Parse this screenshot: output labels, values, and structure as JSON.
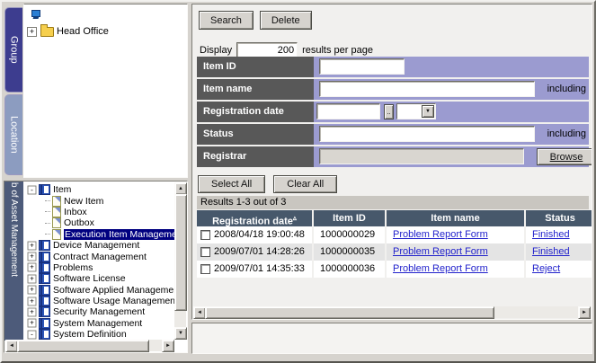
{
  "colors": {
    "window_chrome": "#d6d3ce",
    "panel_bg": "#f1f0ee",
    "form_label_bg": "#585858",
    "form_row_bg": "#9b9bd0",
    "table_header_bg": "#47586b",
    "link_blue": "#2222cc",
    "selection_navy": "#000080",
    "group_tab_bg": "#3d3d8f",
    "location_tab_bg": "#8c9cc0",
    "sidebar_bar_bg": "#4d5b7a"
  },
  "left_top_panel": {
    "tabs": [
      {
        "label": "Group"
      },
      {
        "label": "Location"
      }
    ],
    "tree": {
      "items": [
        {
          "label": "Head Office",
          "expander": "+"
        }
      ]
    }
  },
  "left_bottom_panel": {
    "sidebar_label": "b of Asset Management",
    "tree": [
      {
        "label": "Item",
        "expander": "-"
      },
      {
        "label": "New Item"
      },
      {
        "label": "Inbox"
      },
      {
        "label": "Outbox"
      },
      {
        "label": "Execution Item Management"
      },
      {
        "label": "Device Management",
        "expander": "+"
      },
      {
        "label": "Contract Management",
        "expander": "+"
      },
      {
        "label": "Problems",
        "expander": "+"
      },
      {
        "label": "Software License",
        "expander": "+"
      },
      {
        "label": "Software Applied Management",
        "expander": "+"
      },
      {
        "label": "Software Usage Management",
        "expander": "+"
      },
      {
        "label": "Security Management",
        "expander": "+"
      },
      {
        "label": "System Management",
        "expander": "+"
      },
      {
        "label": "System Definition",
        "expander": "-"
      }
    ]
  },
  "toolbar": {
    "search_label": "Search",
    "delete_label": "Delete"
  },
  "display": {
    "label_before": "Display",
    "value": "200",
    "label_after": "results per page"
  },
  "form": {
    "date_button_label": "..",
    "select_arrow": "▼",
    "rows": [
      {
        "label": "Item ID"
      },
      {
        "label": "Item name",
        "suffix": "including"
      },
      {
        "label": "Registration date"
      },
      {
        "label": "Status",
        "suffix": "including"
      },
      {
        "label": "Registrar",
        "browse_label": "Browse"
      }
    ]
  },
  "selection": {
    "select_all_label": "Select All",
    "clear_all_label": "Clear All"
  },
  "results": {
    "summary": "Results 1-3 out of 3",
    "sort_indicator": "▵",
    "columns": [
      "Registration date",
      "Item ID",
      "Item name",
      "Status"
    ],
    "rows": [
      {
        "registration_date": "2008/04/18 19:00:48",
        "item_id": "1000000029",
        "item_name": "Problem Report Form",
        "status": "Finished"
      },
      {
        "registration_date": "2009/07/01 14:28:26",
        "item_id": "1000000035",
        "item_name": "Problem Report Form",
        "status": "Finished"
      },
      {
        "registration_date": "2009/07/01 14:35:33",
        "item_id": "1000000036",
        "item_name": "Problem Report Form",
        "status": "Reject"
      }
    ]
  },
  "scrollbar_glyphs": {
    "up": "▲",
    "down": "▼",
    "left": "◄",
    "right": "►"
  }
}
